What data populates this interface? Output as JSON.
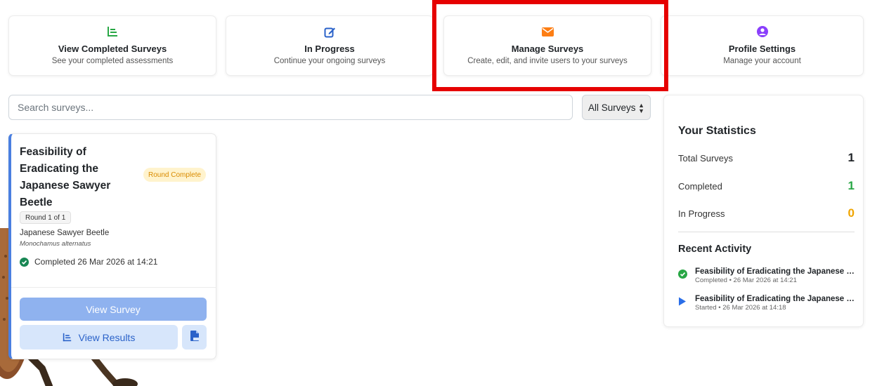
{
  "nav": [
    {
      "title": "View Completed Surveys",
      "subtitle": "See your completed assessments",
      "icon": "chart-list-icon",
      "color": "#28a745"
    },
    {
      "title": "In Progress",
      "subtitle": "Continue your ongoing surveys",
      "icon": "edit-icon",
      "color": "#2a62c9"
    },
    {
      "title": "Manage Surveys",
      "subtitle": "Create, edit, and invite users to your surveys",
      "icon": "envelope-icon",
      "color": "#fd7e14"
    },
    {
      "title": "Profile Settings",
      "subtitle": "Manage your account",
      "icon": "user-circle-icon",
      "color": "#8a3ffc"
    }
  ],
  "search": {
    "placeholder": "Search surveys...",
    "filter_selected": "All Surveys"
  },
  "survey_card": {
    "title": "Feasibility of Eradicating the Japanese Sawyer Beetle",
    "status_badge": "Round Complete",
    "round": "Round 1 of 1",
    "species_common": "Japanese Sawyer Beetle",
    "species_latin": "Monochamus alternatus",
    "completed_text": "Completed 26 Mar 2026 at 14:21",
    "view_survey_label": "View Survey",
    "view_results_label": "View Results",
    "accent_color": "#4a7fe0"
  },
  "stats": {
    "heading": "Your Statistics",
    "rows": [
      {
        "label": "Total Surveys",
        "value": "1",
        "color": "#212529"
      },
      {
        "label": "Completed",
        "value": "1",
        "color": "#28a745"
      },
      {
        "label": "In Progress",
        "value": "0",
        "color": "#f0a500"
      }
    ],
    "recent_heading": "Recent Activity",
    "activity": [
      {
        "title": "Feasibility of Eradicating the Japanese Sawyer Beetle",
        "subtitle": "Completed • 26 Mar 2026 at 14:21",
        "icon": "check-circle-icon"
      },
      {
        "title": "Feasibility of Eradicating the Japanese Sawyer Beetle",
        "subtitle": "Started • 26 Mar 2026 at 14:18",
        "icon": "play-icon"
      }
    ]
  }
}
